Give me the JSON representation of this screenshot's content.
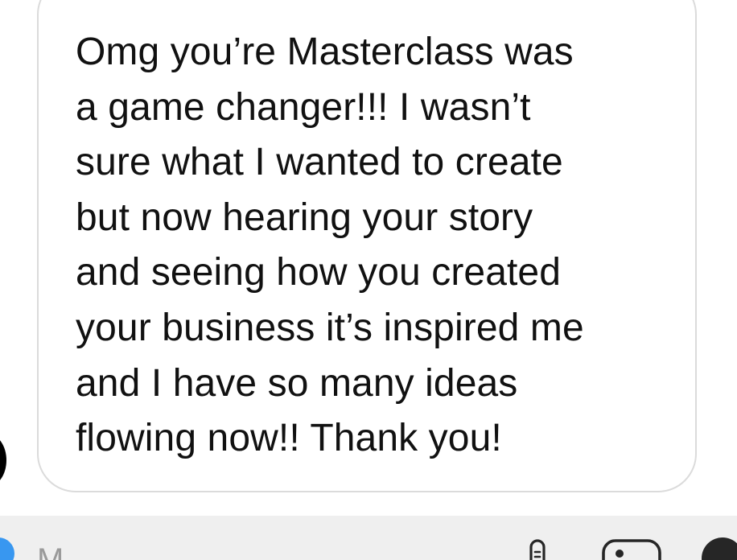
{
  "message": {
    "lines": [
      "Omg you’re Masterclass was",
      "a game changer!!!  I wasn’t",
      "sure what I wanted to create",
      "but now hearing your story",
      "and seeing how you created",
      "your business it’s inspired me",
      "and I have so many ideas",
      "flowing now!! Thank you!"
    ]
  },
  "composer": {
    "placeholder_partial": "M"
  },
  "icons": {
    "mic": "mic-icon",
    "gallery": "gallery-icon",
    "more": "more-icon",
    "camera": "camera-icon"
  },
  "colors": {
    "bubble_border": "#dbdbdb",
    "text": "#111111",
    "composer_bg": "#efefef",
    "camera_button": "#3897f0",
    "more_button": "#262626"
  }
}
